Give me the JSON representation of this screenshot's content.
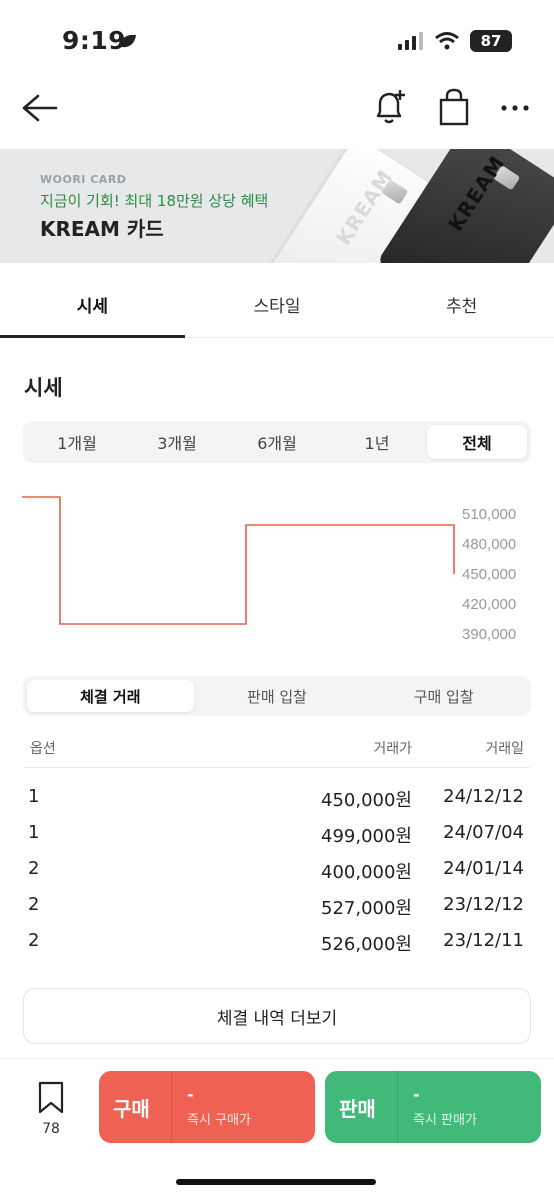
{
  "status_bar": {
    "time": "9:19",
    "battery": "87"
  },
  "banner": {
    "brand": "WOORI CARD",
    "promo": "지금이 기회! 최대 18만원 상당 혜택",
    "title": "KREAM 카드",
    "card_logo": "KREAM"
  },
  "tabs": [
    {
      "label": "시세",
      "active": true
    },
    {
      "label": "스타일",
      "active": false
    },
    {
      "label": "추천",
      "active": false
    }
  ],
  "price_section": {
    "title": "시세",
    "periods": [
      "1개월",
      "3개월",
      "6개월",
      "1년",
      "전체"
    ],
    "selected_period": "전체"
  },
  "chart_data": {
    "type": "line",
    "step": true,
    "color": "#e8604c",
    "y_ticks": [
      "510,000",
      "480,000",
      "450,000",
      "420,000",
      "390,000"
    ],
    "ylim": [
      390000,
      510000
    ],
    "points": [
      {
        "date": "2023-11",
        "value": 526000
      },
      {
        "date": "2023-12-12",
        "value": 527000
      },
      {
        "date": "2024-01-14",
        "value": 400000
      },
      {
        "date": "2024-07-04",
        "value": 499000
      },
      {
        "date": "2024-12-12",
        "value": 450000
      }
    ],
    "grid": false
  },
  "trade_tabs": {
    "items": [
      "체결 거래",
      "판매 입찰",
      "구매 입찰"
    ],
    "selected": "체결 거래"
  },
  "table": {
    "headers": {
      "option": "옵션",
      "price": "거래가",
      "date": "거래일"
    },
    "rows": [
      {
        "option": "1",
        "price": "450,000원",
        "date": "24/12/12"
      },
      {
        "option": "1",
        "price": "499,000원",
        "date": "24/07/04"
      },
      {
        "option": "2",
        "price": "400,000원",
        "date": "24/01/14"
      },
      {
        "option": "2",
        "price": "527,000원",
        "date": "23/12/12"
      },
      {
        "option": "2",
        "price": "526,000원",
        "date": "23/12/11"
      }
    ]
  },
  "more_button": "체결 내역 더보기",
  "bottom_bar": {
    "wish_count": "78",
    "buy": {
      "label": "구매",
      "price": "-",
      "sub": "즉시 구매가",
      "color": "#ef6253"
    },
    "sell": {
      "label": "판매",
      "price": "-",
      "sub": "즉시 판매가",
      "color": "#41b979"
    }
  }
}
